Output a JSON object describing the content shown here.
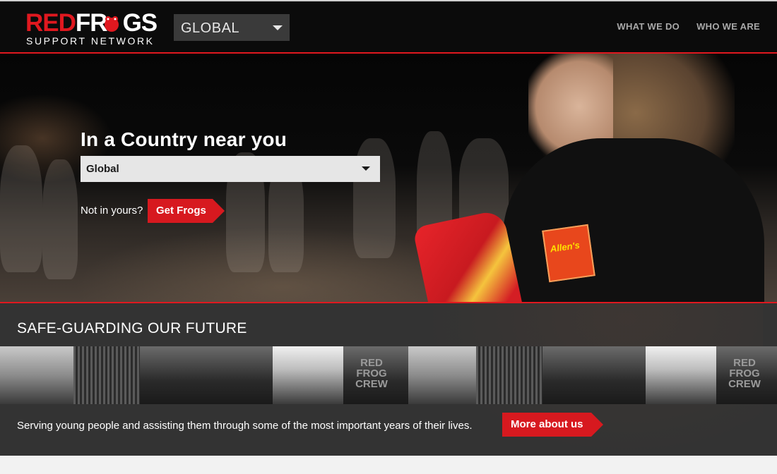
{
  "header": {
    "logo_red": "RED",
    "logo_white": "FR",
    "logo_white2": "GS",
    "logo_sub": "SUPPORT NETWORK",
    "region_value": "GLOBAL",
    "nav": [
      {
        "label": "WHAT WE DO"
      },
      {
        "label": "WHO WE ARE"
      }
    ]
  },
  "hero": {
    "title": "In a Country near you",
    "country_value": "Global",
    "not_yours": "Not in yours?",
    "get_frogs": "Get Frogs",
    "badge_text": "Allen's"
  },
  "section": {
    "title": "SAFE-GUARDING OUR FUTURE",
    "tile_text": "RED FROG CREW",
    "tagline": "Serving young people and assisting them through some of the most important years of their lives.",
    "more_about": "More about us"
  },
  "colors": {
    "brand_red": "#e0181f",
    "button_red": "#d7191f",
    "header_bg": "#0b0b0b"
  }
}
